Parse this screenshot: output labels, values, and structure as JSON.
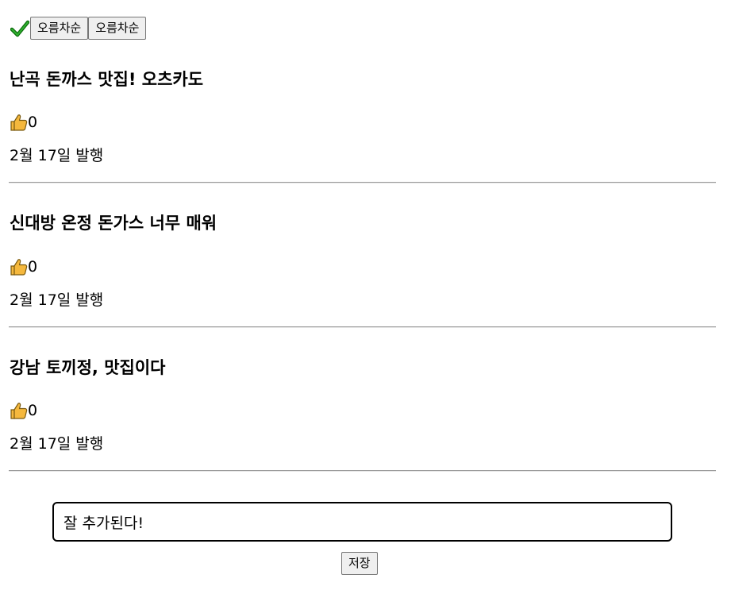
{
  "toolbar": {
    "check_icon": "check-icon",
    "sort_button_1": "오름차순",
    "sort_button_2": "오름차순"
  },
  "posts": [
    {
      "title": "난곡 돈까스 맛집! 오츠카도",
      "likes": "0",
      "date": "2월 17일 발행"
    },
    {
      "title": "신대방 온정 돈가스 너무 매워",
      "likes": "0",
      "date": "2월 17일 발행"
    },
    {
      "title": "강남 토끼정, 맛집이다",
      "likes": "0",
      "date": "2월 17일 발행"
    }
  ],
  "composer": {
    "input_value": "잘 추가된다!",
    "save_label": "저장"
  },
  "colors": {
    "check": "#1a8a1a",
    "thumb": "#f5b83d",
    "divider": "#9a9a9a"
  }
}
